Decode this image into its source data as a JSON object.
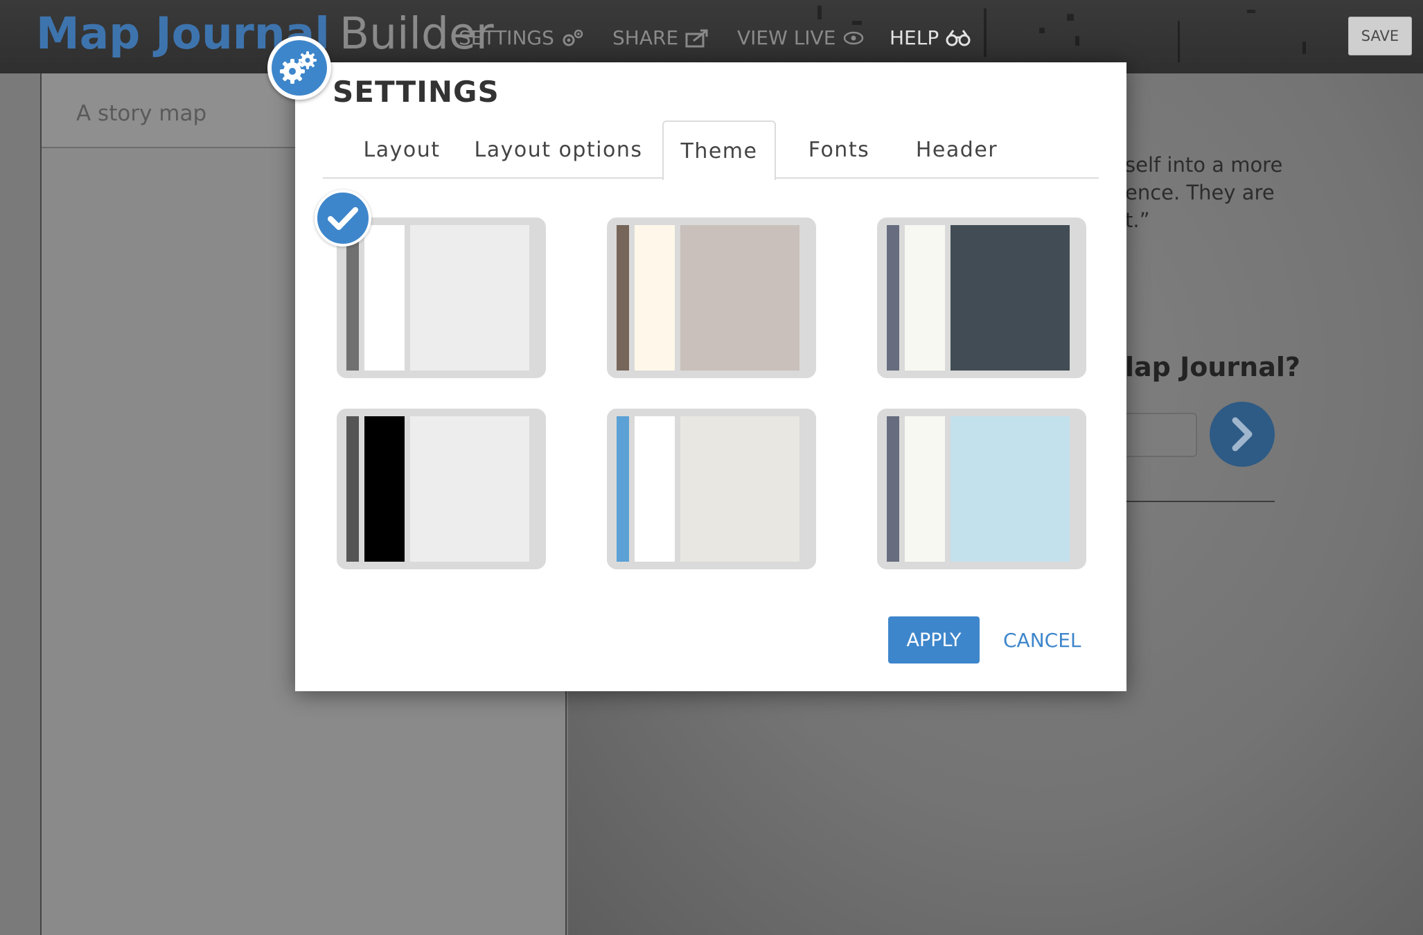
{
  "header": {
    "brand_primary": "Map Journal",
    "brand_secondary": "Builder",
    "nav": {
      "settings": "SETTINGS",
      "share": "SHARE",
      "view_live": "VIEW LIVE",
      "help": "HELP"
    },
    "save_label": "SAVE",
    "icons": [
      "gears-icon",
      "share-icon",
      "eye-icon",
      "binoculars-icon"
    ]
  },
  "background": {
    "left_panel_subtitle": "A story map",
    "text_lines": [
      "self into a more",
      "ence. They are",
      "t.”"
    ],
    "heading": "lap Journal?"
  },
  "dialog": {
    "title": "SETTINGS",
    "tabs": [
      "Layout",
      "Layout options",
      "Theme",
      "Fonts",
      "Header"
    ],
    "active_tab": "Theme",
    "themes": [
      {
        "selected": true,
        "colors": [
          "#707070",
          "#ffffff",
          "#ededed"
        ]
      },
      {
        "selected": false,
        "colors": [
          "#766659",
          "#fff8ea",
          "#c9c0bb"
        ]
      },
      {
        "selected": false,
        "colors": [
          "#676d7f",
          "#f8f8f2",
          "#414c54"
        ]
      },
      {
        "selected": false,
        "colors": [
          "#555555",
          "#000000",
          "#ededed"
        ]
      },
      {
        "selected": false,
        "colors": [
          "#5ba1d6",
          "#ffffff",
          "#e8e7e1"
        ]
      },
      {
        "selected": false,
        "colors": [
          "#676d7f",
          "#f8f8f2",
          "#c3e1ed"
        ]
      }
    ],
    "apply_label": "APPLY",
    "cancel_label": "CANCEL"
  },
  "colors": {
    "accent": "#3e86cb",
    "brand_blue": "#3e74ae",
    "topbar": "#333333"
  }
}
